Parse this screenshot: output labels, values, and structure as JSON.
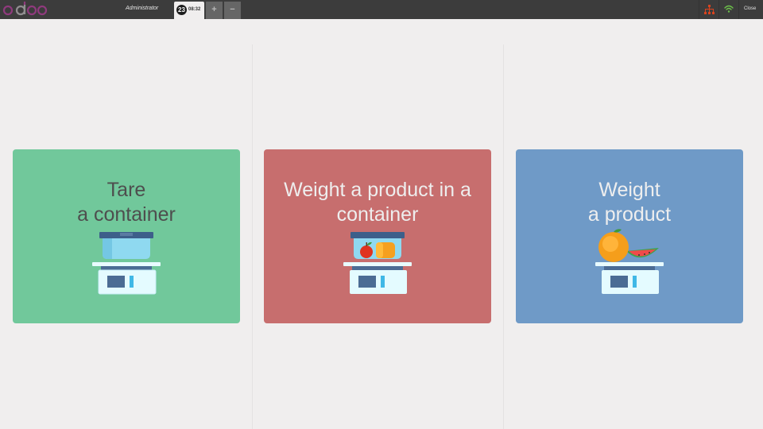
{
  "topbar": {
    "logo_text": "odoo",
    "user": "Administrator",
    "order": {
      "number": "23",
      "time": "08:32"
    },
    "add_order": "+",
    "remove_order": "−",
    "close_label": "Close"
  },
  "actions": [
    {
      "line1": "Tare",
      "line2": "a container"
    },
    {
      "line1": "Weight a product in a",
      "line2": "container"
    },
    {
      "line1": "Weight",
      "line2": "a product"
    }
  ],
  "colors": {
    "topbar": "#3c3c3c",
    "tare": "#71c89b",
    "weight_container": "#c76e6e",
    "weight_product": "#6f9ac7",
    "logo_purple": "#8f3a7d",
    "proxy_status": "#d9431e",
    "network_status": "#6cc04a"
  },
  "icons": {
    "topbar": [
      "odoo-logo",
      "proxy-status-icon",
      "network-status-icon"
    ],
    "cards": [
      "scale-empty-container-icon",
      "scale-container-fruits-icon",
      "scale-fruits-icon"
    ]
  }
}
